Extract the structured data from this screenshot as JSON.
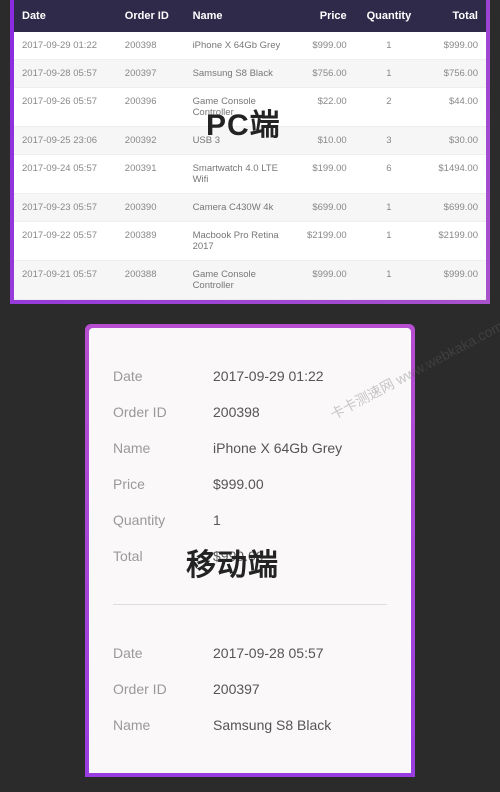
{
  "overlays": {
    "pc_label": "PC端",
    "mobile_label": "移动端",
    "watermark": "卡卡测速网 www.webkaka.com"
  },
  "table": {
    "headers": {
      "date": "Date",
      "order_id": "Order ID",
      "name": "Name",
      "price": "Price",
      "quantity": "Quantity",
      "total": "Total"
    },
    "rows": [
      {
        "date": "2017-09-29 01:22",
        "order_id": "200398",
        "name": "iPhone X 64Gb Grey",
        "price": "$999.00",
        "quantity": "1",
        "total": "$999.00"
      },
      {
        "date": "2017-09-28 05:57",
        "order_id": "200397",
        "name": "Samsung S8 Black",
        "price": "$756.00",
        "quantity": "1",
        "total": "$756.00"
      },
      {
        "date": "2017-09-26 05:57",
        "order_id": "200396",
        "name": "Game Console Controller",
        "price": "$22.00",
        "quantity": "2",
        "total": "$44.00"
      },
      {
        "date": "2017-09-25 23:06",
        "order_id": "200392",
        "name": "USB 3",
        "price": "$10.00",
        "quantity": "3",
        "total": "$30.00"
      },
      {
        "date": "2017-09-24 05:57",
        "order_id": "200391",
        "name": "Smartwatch 4.0 LTE Wifi",
        "price": "$199.00",
        "quantity": "6",
        "total": "$1494.00"
      },
      {
        "date": "2017-09-23 05:57",
        "order_id": "200390",
        "name": "Camera C430W 4k",
        "price": "$699.00",
        "quantity": "1",
        "total": "$699.00"
      },
      {
        "date": "2017-09-22 05:57",
        "order_id": "200389",
        "name": "Macbook Pro Retina 2017",
        "price": "$2199.00",
        "quantity": "1",
        "total": "$2199.00"
      },
      {
        "date": "2017-09-21 05:57",
        "order_id": "200388",
        "name": "Game Console Controller",
        "price": "$999.00",
        "quantity": "1",
        "total": "$999.00"
      }
    ]
  },
  "mobile": {
    "labels": {
      "date": "Date",
      "order_id": "Order ID",
      "name": "Name",
      "price": "Price",
      "quantity": "Quantity",
      "total": "Total"
    },
    "cards": [
      {
        "date": "2017-09-29 01:22",
        "order_id": "200398",
        "name": "iPhone X 64Gb Grey",
        "price": "$999.00",
        "quantity": "1",
        "total": "$999.00"
      },
      {
        "date": "2017-09-28 05:57",
        "order_id": "200397",
        "name": "Samsung S8 Black"
      }
    ]
  }
}
